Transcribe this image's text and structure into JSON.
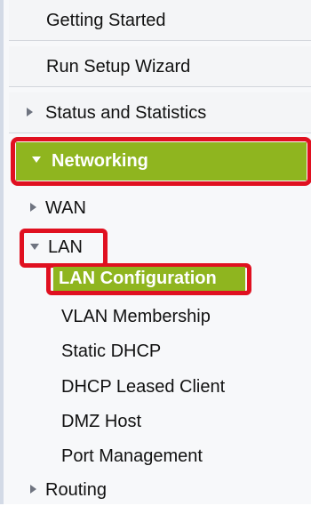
{
  "nav": {
    "getting_started": "Getting Started",
    "run_setup_wizard": "Run Setup Wizard",
    "status_and_statistics": "Status and Statistics",
    "networking": "Networking",
    "wan": "WAN",
    "lan": "LAN",
    "lan_children": {
      "lan_configuration": "LAN Configuration",
      "vlan_membership": "VLAN Membership",
      "static_dhcp": "Static DHCP",
      "dhcp_leased_client": "DHCP Leased Client",
      "dmz_host": "DMZ Host",
      "port_management": "Port Management"
    },
    "routing": "Routing"
  },
  "colors": {
    "active_green": "#8fb51f",
    "highlight_red": "#e01020"
  }
}
